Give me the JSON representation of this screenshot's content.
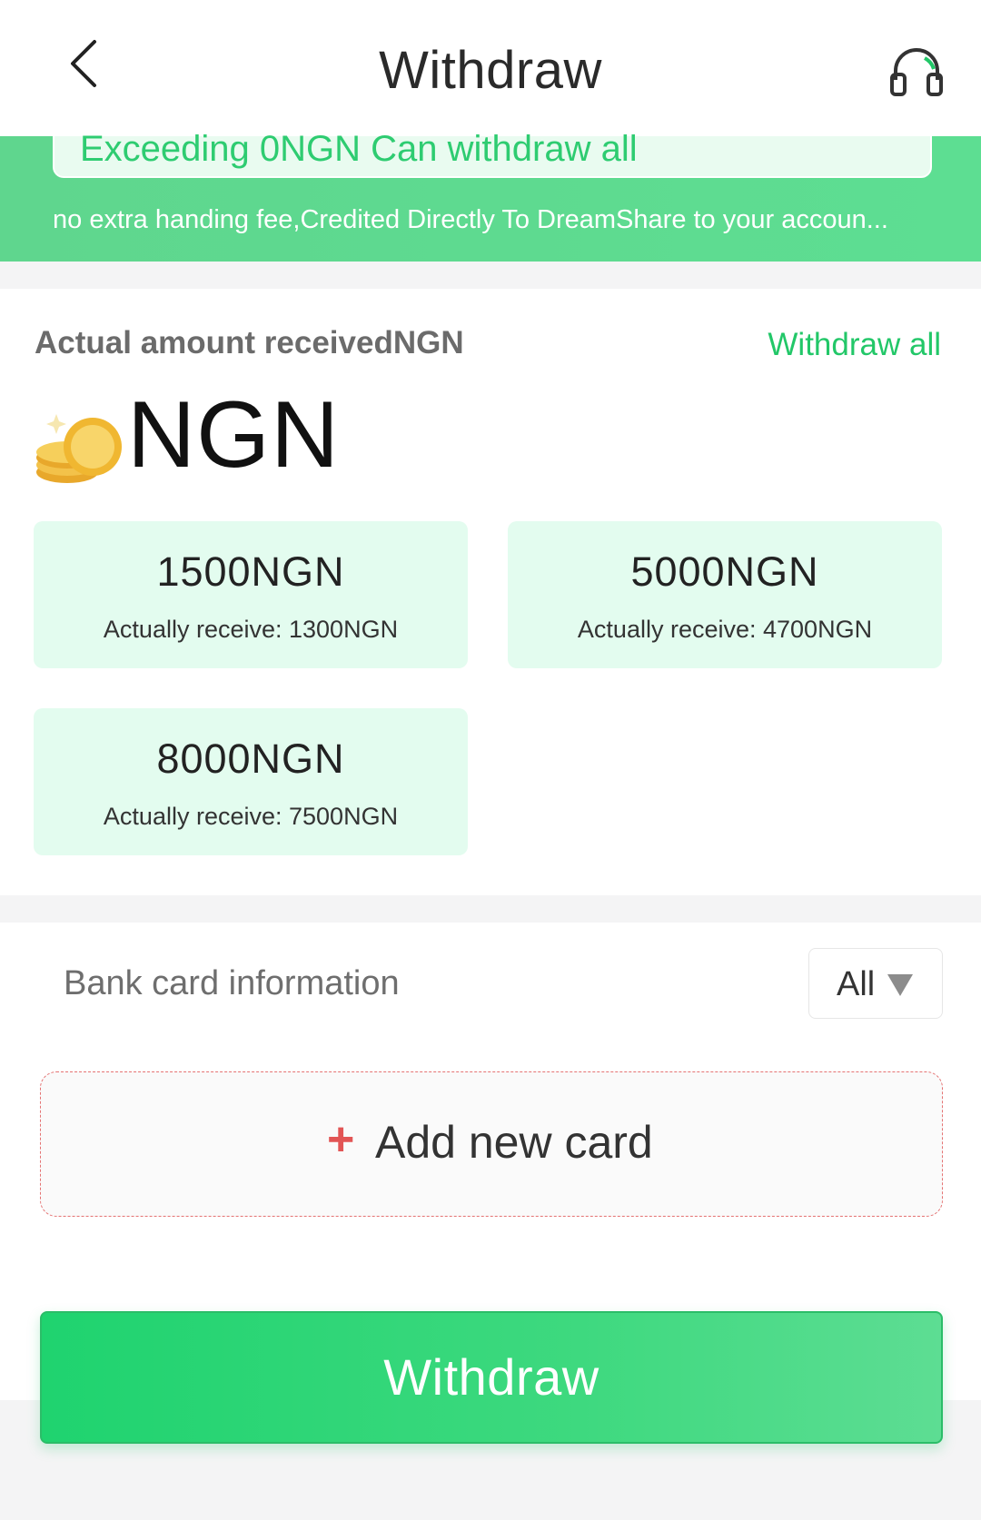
{
  "header": {
    "title": "Withdraw",
    "back_icon": "chevron-left-icon",
    "support_icon": "headset-icon"
  },
  "banner": {
    "highlight": "Exceeding 0NGN Can withdraw all",
    "note": "no extra handing fee,Credited Directly To DreamShare to your accoun..."
  },
  "amount": {
    "received_label": "Actual amount receivedNGN",
    "withdraw_all": "Withdraw all",
    "currency": "NGN",
    "coin_icon": "coin-stack-icon"
  },
  "options": [
    {
      "amount": "1500NGN",
      "receive": "Actually receive: 1300NGN"
    },
    {
      "amount": "5000NGN",
      "receive": "Actually receive: 4700NGN"
    },
    {
      "amount": "8000NGN",
      "receive": "Actually receive: 7500NGN"
    }
  ],
  "bank": {
    "label": "Bank card information",
    "filter_value": "All",
    "add_card_label": "Add new card",
    "add_icon": "plus-icon"
  },
  "action": {
    "withdraw_label": "Withdraw"
  },
  "colors": {
    "accent": "#22c768",
    "banner": "#5dd98f",
    "option_bg": "#e3fcef",
    "add_plus": "#e25555"
  }
}
